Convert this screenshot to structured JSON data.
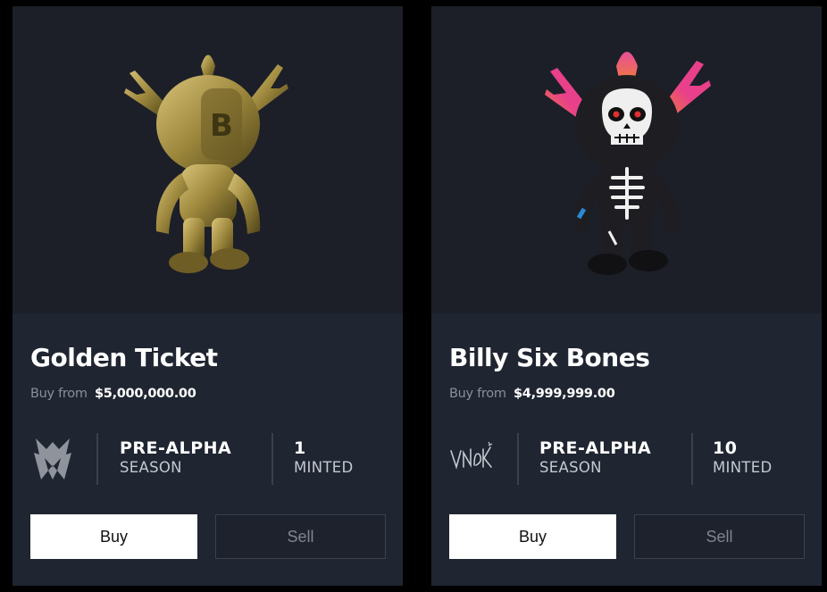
{
  "cards": [
    {
      "title": "Golden Ticket",
      "price_label": "Buy from",
      "price_value": "$5,000,000.00",
      "brand_icon": "m-logo-icon",
      "season_value": "PRE-ALPHA",
      "season_label": "SEASON",
      "minted_value": "1",
      "minted_label": "MINTED",
      "buy_label": "Buy",
      "sell_label": "Sell",
      "figure": "gold-figure"
    },
    {
      "title": "Billy Six Bones",
      "price_label": "Buy from",
      "price_value": "$4,999,999.00",
      "brand_icon": "vnoky-signature-logo",
      "brand_text": "VNOKY",
      "season_value": "PRE-ALPHA",
      "season_label": "SEASON",
      "minted_value": "10",
      "minted_label": "MINTED",
      "buy_label": "Buy",
      "sell_label": "Sell",
      "figure": "skeleton-figure"
    }
  ],
  "colors": {
    "page_bg": "#000000",
    "card_bg": "#1f2531",
    "art_bg": "#1c1f28",
    "gold": "#a8934a",
    "horn_pink": "#e8408a",
    "horn_orange": "#f07a3a"
  }
}
